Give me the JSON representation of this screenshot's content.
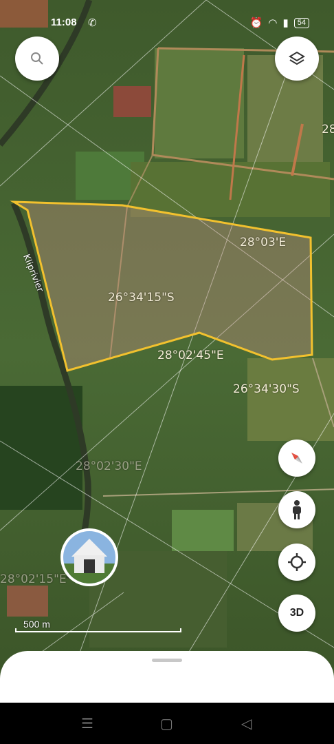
{
  "status_bar": {
    "time": "11:08",
    "battery": "54"
  },
  "map": {
    "coordinate_labels": [
      {
        "text": "28°03'E",
        "faint": false
      },
      {
        "text": "26°34'15\"S",
        "faint": false
      },
      {
        "text": "28°02'45\"E",
        "faint": false
      },
      {
        "text": "26°34'30\"S",
        "faint": false
      },
      {
        "text": "28°02'30\"E",
        "faint": true
      },
      {
        "text": "28°02'15\"E",
        "faint": true
      },
      {
        "text": "28",
        "faint": false
      }
    ],
    "river_label": "Kliprivier",
    "scale_label": "500 m",
    "polygon_color": "#f2c12e"
  },
  "buttons": {
    "search_icon": "search-icon",
    "layers_icon": "layers-icon",
    "compass_icon": "compass-icon",
    "streetview_icon": "pegman-icon",
    "location_icon": "crosshair-icon",
    "three_d_label": "3D"
  },
  "nav": {
    "menu": "☰",
    "home": "▢",
    "back": "◁"
  }
}
